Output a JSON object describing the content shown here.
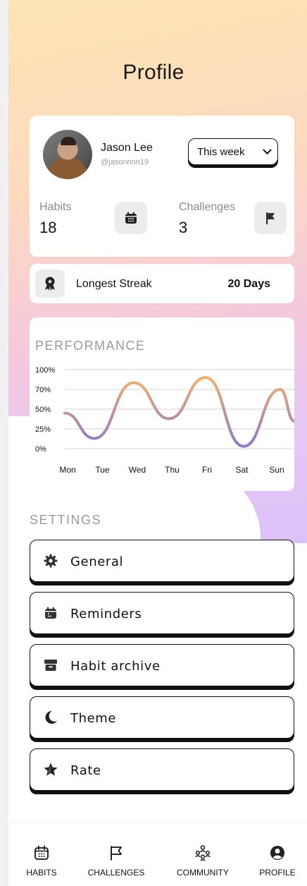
{
  "header": {
    "title": "Profile"
  },
  "profile": {
    "name": "Jason Lee",
    "handle": "@jasonnnn19",
    "period_selected": "This week"
  },
  "stats": {
    "habits_label": "Habits",
    "habits_value": "18",
    "challenges_label": "Challenges",
    "challenges_value": "3"
  },
  "streak": {
    "label": "Longest Streak",
    "value": "20 Days"
  },
  "performance": {
    "title": "PERFORMANCE"
  },
  "chart_data": {
    "type": "line",
    "x": [
      "Mon",
      "Tue",
      "Wed",
      "Thu",
      "Fri",
      "Sat",
      "Sun"
    ],
    "y_ticks": [
      "100%",
      "70%",
      "50%",
      "25%",
      "0%"
    ],
    "series": [
      {
        "values": [
          45,
          13,
          80,
          38,
          88,
          3,
          70,
          35
        ]
      }
    ],
    "ylim": [
      0,
      100
    ],
    "grid": true,
    "colors": [
      "#8e79cc",
      "#f2b06e"
    ]
  },
  "settings": {
    "title": "SETTINGS",
    "items": [
      {
        "label": "General",
        "icon": "gear-icon"
      },
      {
        "label": "Reminders",
        "icon": "calendar-icon"
      },
      {
        "label": "Habit archive",
        "icon": "archive-icon"
      },
      {
        "label": "Theme",
        "icon": "moon-icon"
      },
      {
        "label": "Rate",
        "icon": "star-icon"
      }
    ]
  },
  "tabbar": {
    "items": [
      {
        "label": "HABITS",
        "icon": "calendar-icon"
      },
      {
        "label": "CHALLENGES",
        "icon": "flag-icon"
      },
      {
        "label": "COMMUNITY",
        "icon": "community-icon"
      },
      {
        "label": "PROFILE",
        "icon": "user-icon"
      }
    ]
  }
}
